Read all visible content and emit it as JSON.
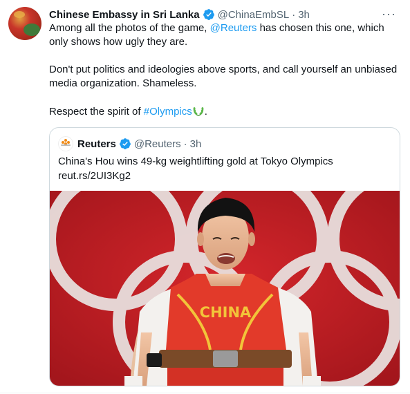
{
  "tweet": {
    "author_name": "Chinese Embassy in Sri Lanka",
    "handle": "@ChinaEmbSL",
    "time": "3h",
    "separator": "·",
    "more": "···",
    "body": {
      "p1_a": "Among all the photos of the game, ",
      "p1_mention": "@Reuters",
      "p1_b": " has chosen this one, which only shows how ugly they are.",
      "p2": "Don't put politics and ideologies above sports, and call yourself an unbiased media organization. Shameless.",
      "p3_a": "Respect the spirit of ",
      "p3_hashtag": "#Olympics",
      "p3_b": "."
    }
  },
  "quoted": {
    "author_name": "Reuters",
    "handle": "@Reuters",
    "time": "3h",
    "separator": "·",
    "headline": "China's Hou wins 49-kg weightlifting gold at Tokyo Olympics",
    "link": "reut.rs/2UI3Kg2",
    "photo": {
      "jersey_text": "CHINA"
    }
  },
  "colors": {
    "link": "#1d9bf0",
    "muted": "#536471",
    "verified": "#1d9bf0",
    "photo_red": "#c41e24",
    "ring_white": "#e9e4e2",
    "jersey_gold": "#f2c43a"
  },
  "icons": {
    "verified": "verified-badge-icon",
    "more": "more-options-icon",
    "olympic_wreath": "laurel-wreath-emoji",
    "reuters_logo": "reuters-logo-icon"
  }
}
